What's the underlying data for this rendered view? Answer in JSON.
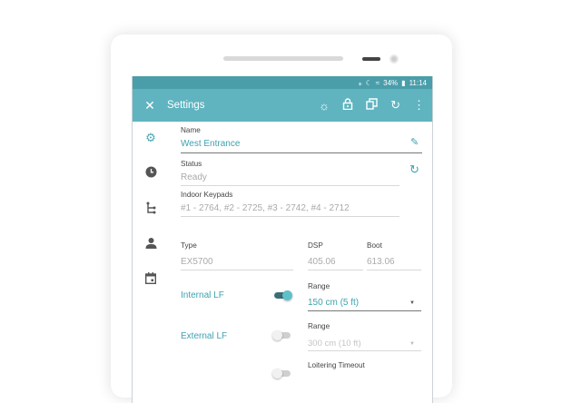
{
  "status_bar": {
    "battery": "34%",
    "time": "11:14"
  },
  "toolbar": {
    "title": "Settings"
  },
  "form": {
    "name_label": "Name",
    "name_value": "West Entrance",
    "status_label": "Status",
    "status_value": "Ready",
    "keypads_label": "Indoor Keypads",
    "keypads_value": "#1 - 2764, #2 - 2725, #3 - 2742, #4 - 2712",
    "type_label": "Type",
    "type_value": "EX5700",
    "dsp_label": "DSP",
    "dsp_value": "405.06",
    "boot_label": "Boot",
    "boot_value": "613.06",
    "internal_lf_label": "Internal LF",
    "internal_lf_on": true,
    "internal_range_label": "Range",
    "internal_range_value": "150 cm (5 ft)",
    "external_lf_label": "External LF",
    "external_lf_on": false,
    "external_range_label": "Range",
    "external_range_value": "300 cm (10 ft)",
    "loitering_label": "Loitering Timeout"
  },
  "colors": {
    "accent": "#5fb4c0",
    "accent_dark": "#4a9eaa",
    "teal_text": "#3ea2b0"
  }
}
